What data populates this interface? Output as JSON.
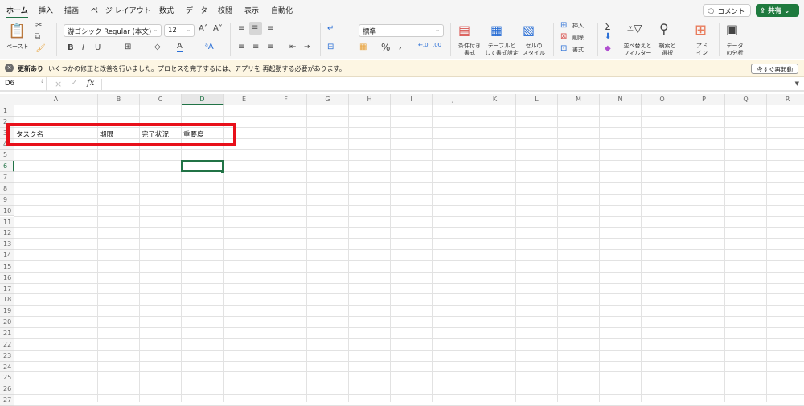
{
  "tabs": [
    "ホーム",
    "挿入",
    "描画",
    "ページ レイアウト",
    "数式",
    "データ",
    "校閲",
    "表示",
    "自動化"
  ],
  "ribbon": {
    "paste": "ペースト",
    "font_name": "游ゴシック Regular (本文)",
    "font_size": "12",
    "number_format": "標準",
    "cond_format": [
      "条件付き",
      "書式"
    ],
    "table_format": [
      "テーブルと",
      "して書式設定"
    ],
    "cell_style": [
      "セルの",
      "スタイル"
    ],
    "insert": "挿入",
    "delete": "削除",
    "format": "書式",
    "sort_filter": [
      "並べ替えと",
      "フィルター"
    ],
    "find_select": [
      "検索と",
      "選択"
    ],
    "addin": [
      "アド",
      "イン"
    ],
    "analyze": [
      "データ",
      "の分析"
    ]
  },
  "comment_label": "コメント",
  "share_label": "共有",
  "notice": {
    "title": "更新あり",
    "message": "いくつかの修正と改善を行いました。プロセスを完了するには、アプリを 再起動する必要があります。",
    "button": "今すぐ再起動"
  },
  "formula_bar": {
    "name_box": "D6",
    "fx": "fx",
    "value": ""
  },
  "columns": [
    "A",
    "B",
    "C",
    "D",
    "E",
    "F",
    "G",
    "H",
    "I",
    "J",
    "K",
    "L",
    "M",
    "N",
    "O",
    "P",
    "Q",
    "R"
  ],
  "rows": [
    "1",
    "2",
    "3",
    "4",
    "5",
    "6",
    "7",
    "8",
    "9",
    "10",
    "11",
    "12",
    "13",
    "14",
    "15",
    "16",
    "17",
    "18",
    "19",
    "20",
    "21",
    "22",
    "23",
    "24",
    "25",
    "26",
    "27"
  ],
  "cells": {
    "A3": "タスク名",
    "B3": "期限",
    "C3": "完了状況",
    "D3": "重要度"
  },
  "selected_cell": "D6",
  "colors": {
    "accent": "#217346",
    "highlight_box": "#e8101a"
  }
}
